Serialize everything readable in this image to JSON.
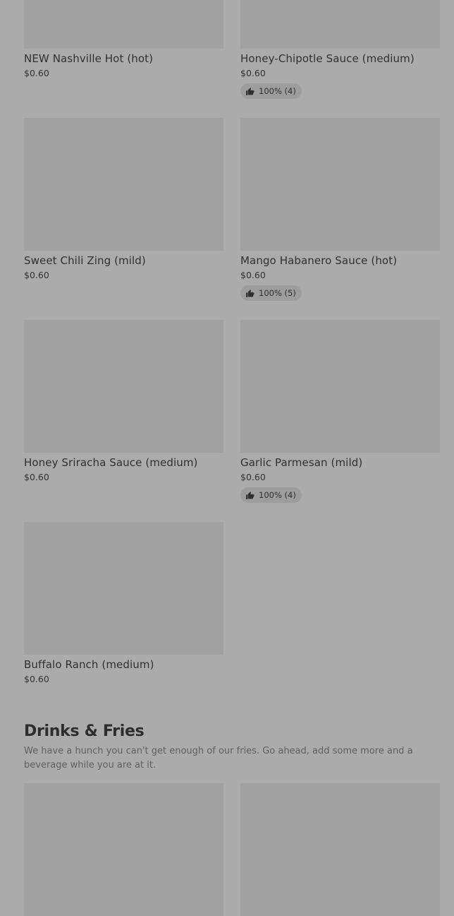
{
  "items": [
    {
      "name": "NEW Nashville Hot (hot)",
      "price": "$0.60",
      "rating": ""
    },
    {
      "name": "Honey-Chipotle Sauce (medium)",
      "price": "$0.60",
      "rating": "100% (4)"
    },
    {
      "name": "Sweet Chili Zing (mild)",
      "price": "$0.60",
      "rating": ""
    },
    {
      "name": "Mango Habanero Sauce (hot)",
      "price": "$0.60",
      "rating": "100% (5)"
    },
    {
      "name": "Honey Sriracha Sauce (medium)",
      "price": "$0.60",
      "rating": ""
    },
    {
      "name": "Garlic Parmesan (mild)",
      "price": "$0.60",
      "rating": "100% (4)"
    },
    {
      "name": "Buffalo Ranch (medium)",
      "price": "$0.60",
      "rating": ""
    }
  ],
  "section": {
    "title": "Drinks & Fries",
    "description": "We have a hunch you can't get enough of our fries. Go ahead, add some more and a beverage while you are at it."
  },
  "icons": {
    "rating": "thumbs-up-icon"
  },
  "colors": {
    "overlay_background": "#ababab",
    "image_placeholder": "#a1a1a1",
    "badge_background": "#9d9d9d"
  }
}
